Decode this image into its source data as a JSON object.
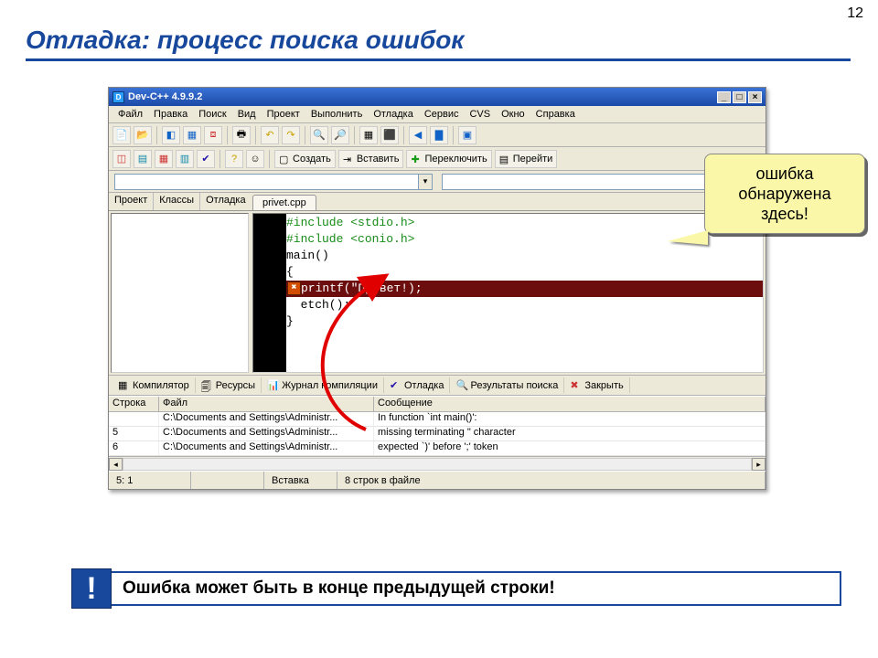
{
  "page_number": "12",
  "slide_title": "Отладка: процесс поиска ошибок",
  "app_title": "Dev-C++ 4.9.9.2",
  "window_buttons": {
    "min": "_",
    "max": "□",
    "close": "×"
  },
  "menus": [
    "Файл",
    "Правка",
    "Поиск",
    "Вид",
    "Проект",
    "Выполнить",
    "Отладка",
    "Сервис",
    "CVS",
    "Окно",
    "Справка"
  ],
  "toolbar2": {
    "create": "Создать",
    "insert": "Вставить",
    "switch": "Переключить",
    "goto": "Перейти"
  },
  "side_tabs": {
    "project": "Проект",
    "classes": "Классы",
    "debug": "Отладка"
  },
  "file_tab": "privet.cpp",
  "code": {
    "l1": "#include <stdio.h>",
    "l2": "#include <conio.h>",
    "l3": "main()",
    "l4": "{",
    "err": "printf(\"Привет!);",
    "l6": "  etch();",
    "l7": "}"
  },
  "bottom_tabs": {
    "compiler": "Компилятор",
    "resources": "Ресурсы",
    "log": "Журнал компиляции",
    "debug": "Отладка",
    "search": "Результаты поиска",
    "close": "Закрыть"
  },
  "grid": {
    "headers": {
      "line": "Строка",
      "file": "Файл",
      "message": "Сообщение"
    },
    "rows": [
      {
        "line": "",
        "file": "C:\\Documents and Settings\\Administr...",
        "msg": "In function `int main()':"
      },
      {
        "line": "5",
        "file": "C:\\Documents and Settings\\Administr...",
        "msg": "missing terminating \" character"
      },
      {
        "line": "6",
        "file": "C:\\Documents and Settings\\Administr...",
        "msg": "expected `)' before ';' token"
      }
    ]
  },
  "statusbar": {
    "pos": "5: 1",
    "mode": "Вставка",
    "info": "8 строк в файле"
  },
  "callout_text_l1": "ошибка",
  "callout_text_l2": "обнаружена",
  "callout_text_l3": "здесь!",
  "note_text": "Ошибка может быть в конце предыдущей строки!",
  "colors": {
    "brand_blue": "#18489c",
    "callout_bg": "#faf8a8",
    "err_bg": "#6c0e0e"
  }
}
